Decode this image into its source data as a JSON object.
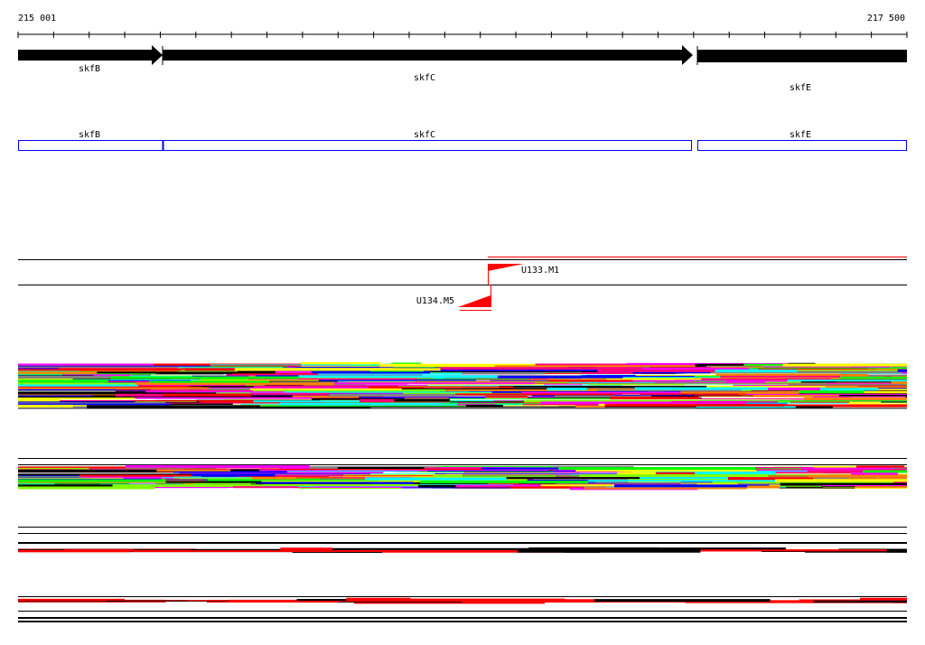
{
  "ruler": {
    "start_label": "215 001",
    "end_label": "217 500"
  },
  "genes": [
    {
      "name": "skfB",
      "strand": "+"
    },
    {
      "name": "skfC",
      "strand": "+"
    },
    {
      "name": "skfE",
      "strand": "+"
    }
  ],
  "cds": [
    {
      "name": "skfB"
    },
    {
      "name": "skfC"
    },
    {
      "name": "skfE"
    }
  ],
  "features": [
    {
      "name": "U133.M1",
      "color": "#ff0000"
    },
    {
      "name": "U134.M5",
      "color": "#ff0000"
    }
  ],
  "colors": {
    "gene": "#000000",
    "cds": "#0000ff",
    "feature": "#ff0000"
  }
}
